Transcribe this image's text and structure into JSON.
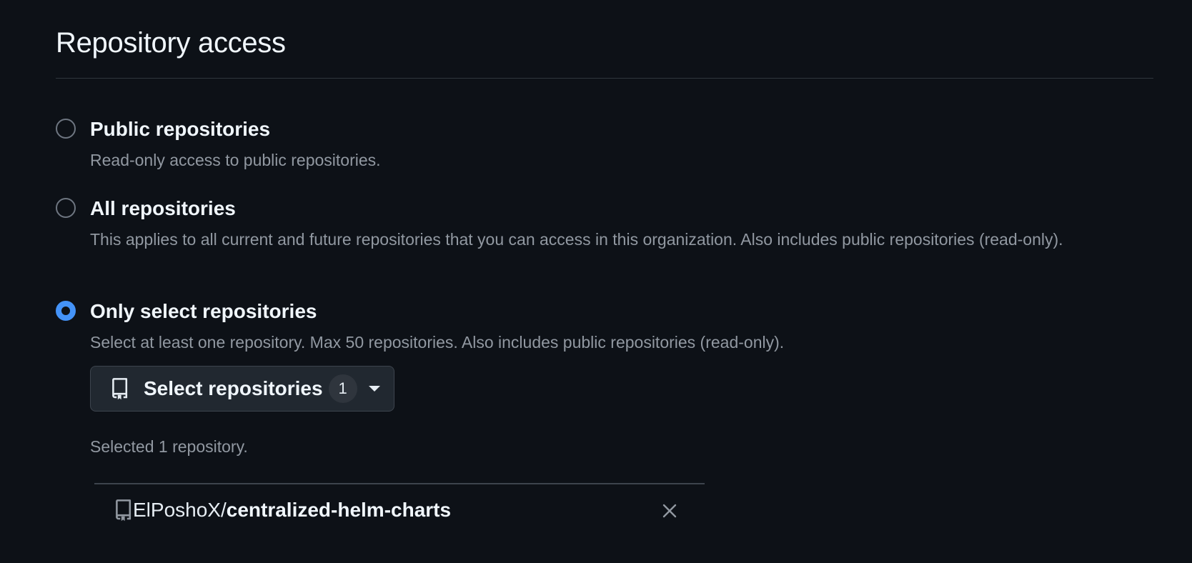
{
  "section": {
    "title": "Repository access"
  },
  "options": [
    {
      "label": "Public repositories",
      "description": "Read-only access to public repositories.",
      "checked": false
    },
    {
      "label": "All repositories",
      "description": "This applies to all current and future repositories that you can access in this organization. Also includes public repositories (read-only).",
      "checked": false
    },
    {
      "label": "Only select repositories",
      "description": "Select at least one repository. Max 50 repositories. Also includes public repositories (read-only).",
      "checked": true
    }
  ],
  "select_button": {
    "label": "Select repositories",
    "count": "1",
    "icon": "repo-icon"
  },
  "selected_note": "Selected 1 repository.",
  "selected_repos": [
    {
      "owner": "ElPoshoX",
      "separator": "/",
      "name": "centralized-helm-charts",
      "icon": "repo-icon",
      "remove_icon": "close-icon"
    }
  ],
  "colors": {
    "background": "#0d1117",
    "accent": "#4493f8",
    "muted_text": "#9198a1",
    "border": "#30363d"
  }
}
